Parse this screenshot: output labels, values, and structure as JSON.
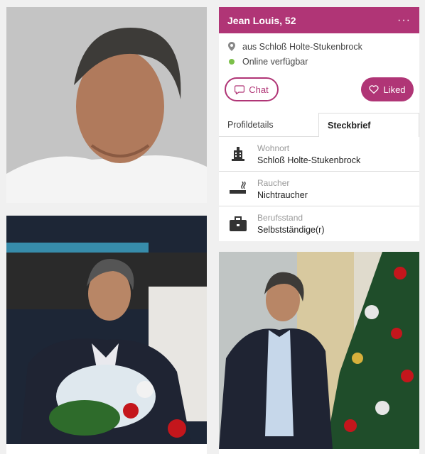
{
  "profile": {
    "name_age": "Jean Louis, 52",
    "more_label": "···",
    "location": "aus Schloß Holte-Stukenbrock",
    "online_status": "Online verfügbar",
    "online_color": "#7cc04a",
    "accent_color": "#b03576"
  },
  "actions": {
    "chat_label": "Chat",
    "chat_icon": "chat-bubble-icon",
    "liked_label": "Liked",
    "liked_icon": "heart-outline-icon"
  },
  "tabs": [
    {
      "label": "Profildetails",
      "active": false
    },
    {
      "label": "Steckbrief",
      "active": true
    }
  ],
  "details": [
    {
      "icon": "building-icon",
      "label": "Wohnort",
      "value": "Schloß Holte-Stukenbrock"
    },
    {
      "icon": "cigarette-icon",
      "label": "Raucher",
      "value": "Nichtraucher"
    },
    {
      "icon": "briefcase-icon",
      "label": "Berufsstand",
      "value": "Selbstständige(r)"
    }
  ]
}
